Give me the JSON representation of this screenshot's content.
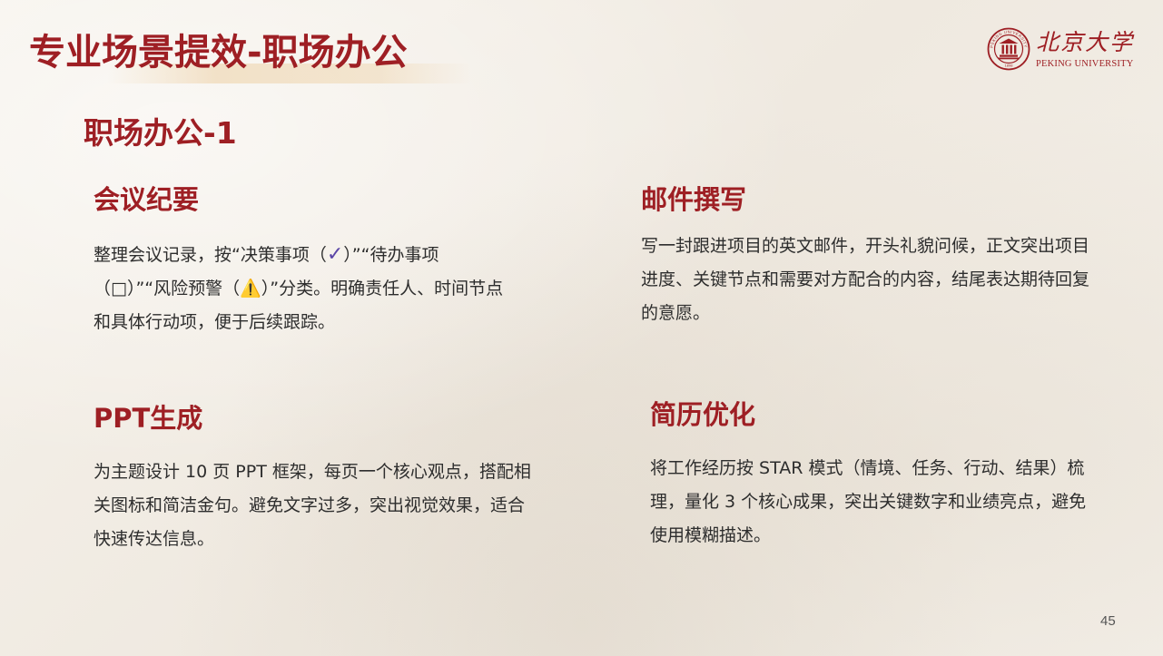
{
  "header": {
    "title": "专业场景提效-职场办公",
    "logo": {
      "name_cn": "北京大学",
      "name_en": "PEKING UNIVERSITY",
      "seal_text": "PEKING UNIVERSITY",
      "seal_year": "1898"
    }
  },
  "section": {
    "heading": "职场办公-1"
  },
  "cards": {
    "meeting": {
      "title": "会议纪要",
      "text_before": "整理会议记录，按“决策事项（",
      "check_icon": "✓",
      "text_after": "）”“待办事项（□）”“风险预警（⚠️）”分类。明确责任人、时间节点和具体行动项，便于后续跟踪。"
    },
    "email": {
      "title": "邮件撰写",
      "body": "写一封跟进项目的英文邮件，开头礼貌问候，正文突出项目进度、关键节点和需要对方配合的内容，结尾表达期待回复的意愿。"
    },
    "ppt": {
      "title": "PPT生成",
      "body": "为主题设计 10 页 PPT 框架，每页一个核心观点，搭配相关图标和简洁金句。避免文字过多，突出视觉效果，适合快速传达信息。"
    },
    "resume": {
      "title": "简历优化",
      "body": "将工作经历按 STAR 模式（情境、任务、行动、结果）梳理，量化 3 个核心成果，突出关键数字和业绩亮点，避免使用模糊描述。"
    }
  },
  "footer": {
    "page_number": "45"
  },
  "colors": {
    "accent": "#9e1f24",
    "body_text": "#2d2d2d",
    "check_icon": "#5a45a6",
    "background": "#f3efe8"
  },
  "icons": {
    "seal": "peking-university-seal-icon",
    "check": "check-mark-icon"
  }
}
